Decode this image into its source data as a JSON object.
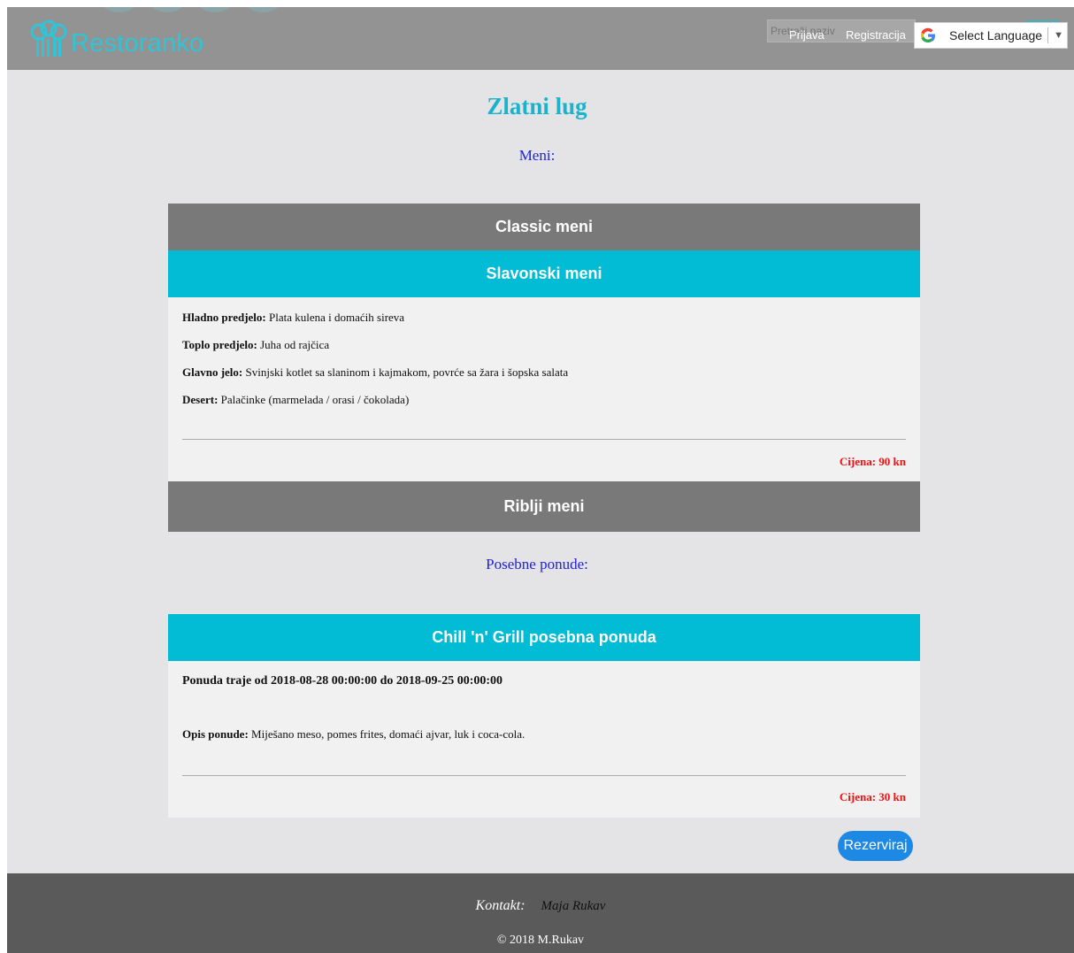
{
  "header": {
    "brand": "Restoranko",
    "search_placeholder": "Pretraži naziv",
    "login": "Prijava",
    "register": "Registracija",
    "language": "Select Language"
  },
  "restaurant": {
    "name": "Zlatni lug",
    "menu_heading": "Meni:",
    "offers_heading": "Posebne ponude:"
  },
  "menus": [
    {
      "title": "Classic meni"
    },
    {
      "title": "Slavonski meni",
      "items": [
        {
          "label": "Hladno predjelo:",
          "value": "Plata kulena i domaćih sireva"
        },
        {
          "label": "Toplo predjelo:",
          "value": "Juha od rajčica"
        },
        {
          "label": "Glavno jelo:",
          "value": "Svinjski kotlet sa slaninom i kajmakom, povrće sa žara i šopska salata"
        },
        {
          "label": "Desert:",
          "value": "Palačinke (marmelada / orasi / čokolada)"
        }
      ],
      "price": "Cijena: 90 kn"
    },
    {
      "title": "Riblji meni"
    }
  ],
  "offer": {
    "title": "Chill 'n' Grill posebna ponuda",
    "duration": "Ponuda traje od 2018-08-28 00:00:00 do 2018-09-25 00:00:00",
    "desc_label": "Opis ponude:",
    "desc_value": "Miješano meso, pomes frites, domaći ajvar, luk i coca-cola.",
    "price": "Cijena: 30 kn"
  },
  "reserve_button": "Rezerviraj",
  "footer": {
    "contact_label": "Kontakt:",
    "contact_name": "Maja Rukav",
    "copyright": "© 2018 M.Rukav"
  },
  "colors": {
    "accent": "#02bcd6",
    "header": "#939393",
    "gray_bar": "#797979",
    "price": "#ee1111",
    "button": "#1e88e5"
  }
}
